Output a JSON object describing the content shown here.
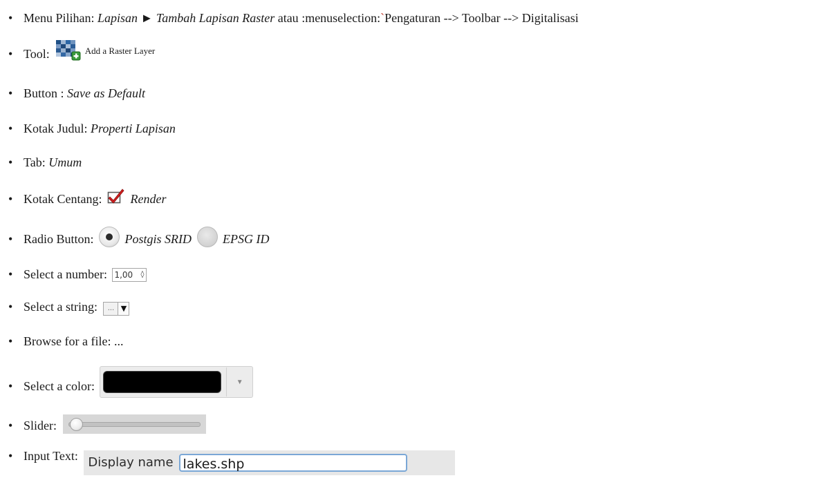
{
  "items": [
    {
      "label": "Menu Pilihan:",
      "menu_path": "Lapisan ► Tambah Lapisan Raster",
      "connector": "atau",
      "menu_code_prefix": ":menuselection:",
      "menu_code_tick": "`",
      "menu_code_rest": "Pengaturan --> Toolbar --> Digitalisasi"
    },
    {
      "label": "Tool:",
      "icon": "add-raster-layer-icon",
      "icon_caption": "Add a Raster Layer"
    },
    {
      "label": "Button :",
      "value": "Save as Default"
    },
    {
      "label": "Kotak Judul:",
      "value": "Properti Lapisan"
    },
    {
      "label": "Tab:",
      "value": "Umum"
    },
    {
      "label": "Kotak Centang:",
      "icon": "checkbox-checked-icon",
      "value": "Render"
    },
    {
      "label": "Radio Button:",
      "option1": "Postgis SRID",
      "option2": "EPSG ID"
    },
    {
      "label": "Select a number:",
      "value": "1,00",
      "arrows": "◊"
    },
    {
      "label": "Select a string:",
      "dots": "...",
      "arrow": "▼"
    },
    {
      "label": "Browse for a file:",
      "value": "..."
    },
    {
      "label": "Select a color:",
      "color": "#000000",
      "arrow": "▼"
    },
    {
      "label": "Slider:",
      "level": 0.0
    },
    {
      "label": "Input Text:",
      "field_label": "Display name",
      "field_value": "lakes.shp"
    }
  ],
  "bullet": "•",
  "colors": {
    "text": "#1a1a1a",
    "tick": "#c0392b",
    "input_border": "#7aa7d6",
    "checkbox_red": "#d11f1f"
  }
}
